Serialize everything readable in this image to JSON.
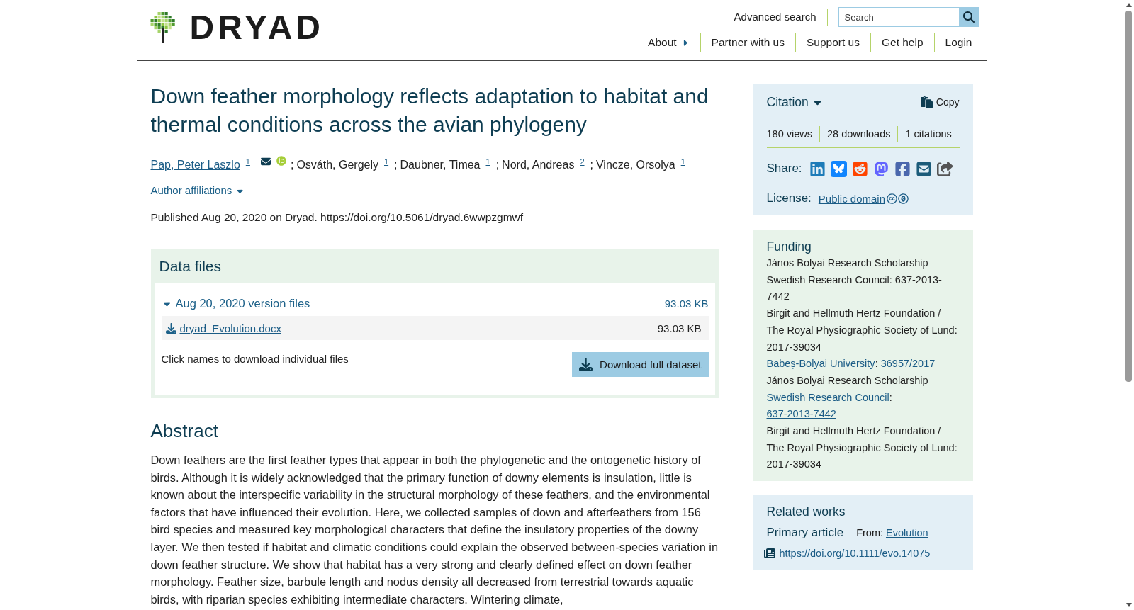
{
  "header": {
    "logo_text": "DRYAD",
    "advanced_search": "Advanced search",
    "search": {
      "placeholder": "Search"
    },
    "menu": {
      "label": "About",
      "expanded": false
    },
    "links": [
      "Partner with us",
      "Support us",
      "Get help",
      "Login"
    ]
  },
  "title": "Down feather morphology reflects adaptation to habitat and thermal conditions across the avian phylogeny",
  "authors": [
    {
      "name": "Pap, Peter Laszlo",
      "linked": true,
      "affiliation": "1",
      "email": true,
      "orcid": true
    },
    {
      "separator": ";",
      "name": "Osváth, Gergely",
      "linked": false,
      "affiliation": "1"
    },
    {
      "separator": ";",
      "name": "Daubner, Timea",
      "linked": false,
      "affiliation": "1"
    },
    {
      "separator": ";",
      "name": "Nord, Andreas",
      "linked": false,
      "affiliation": "2"
    },
    {
      "separator": ";",
      "name": "Vincze, Orsolya",
      "linked": false,
      "affiliation": "1"
    }
  ],
  "author_affiliations": {
    "label": "Author affiliations",
    "expanded": false
  },
  "published": "Published Aug 20, 2020 on Dryad. https://doi.org/10.5061/dryad.6wwpzgmwf",
  "data_files": {
    "title": "Data files",
    "versions": [
      {
        "label": "Aug 20, 2020 version files",
        "size": "93.03 KB",
        "expanded": true,
        "files": [
          {
            "name": "dryad_Evolution.docx",
            "size": "93.03 KB"
          }
        ]
      }
    ],
    "hint": "Click names to download individual files",
    "download_button": "Download full dataset"
  },
  "abstract": {
    "title": "Abstract",
    "text": "Down feathers are the first feather types that appear in both the phylogenetic and the ontogenetic history of birds. Although it is widely acknowledged that the primary function of downy elements is insulation, little is known about the interspecific variability in the structural morphology of these feathers, and the environmental factors that have influenced their evolution. Here, we collected samples of down and afterfeathers from 156 bird species and measured key morphological characters that define the insulatory properties of the downy layer. We then tested if habitat and climatic conditions could explain the observed between-species variation in down feather structure. We show that habitat has a very strong and clearly defined effect on down feather morphology. Feather size, barbule length and nodus density all decreased from terrestrial towards aquatic birds, with riparian species exhibiting intermediate characters. Wintering climate,"
  },
  "citation": {
    "label": "Citation",
    "expanded": false,
    "copy": "Copy",
    "stats": [
      "180 views",
      "28 downloads",
      "1 citations"
    ],
    "share_label": "Share:",
    "license_label": "License:",
    "license": "Public domain"
  },
  "funding": {
    "title": "Funding",
    "entries": [
      {
        "kind": "plain",
        "text": "János Bolyai Research Scholarship"
      },
      {
        "kind": "plain",
        "text": "Swedish Research Council: 637-2013-7442"
      },
      {
        "kind": "plain",
        "text": "Birgit and Hellmuth Hertz Foundation / The Royal Physiographic Society of Lund: 2017-39034"
      },
      {
        "kind": "linked",
        "funder": "Babeș-Bolyai University",
        "separator": ":",
        "award": "36957/2017"
      },
      {
        "kind": "plain",
        "text": "János Bolyai Research Scholarship"
      },
      {
        "kind": "linked",
        "funder": "Swedish Research Council",
        "separator": ":",
        "award": "637-2013-7442"
      },
      {
        "kind": "plain",
        "text": "Birgit and Hellmuth Hertz Foundation / The Royal Physiographic Society of Lund: 2017-39034"
      }
    ]
  },
  "related_works": {
    "title": "Related works",
    "items": [
      {
        "type": "Primary article",
        "from_label": "From:",
        "source": "Evolution",
        "url": "https://doi.org/10.1111/evo.14075"
      }
    ]
  }
}
